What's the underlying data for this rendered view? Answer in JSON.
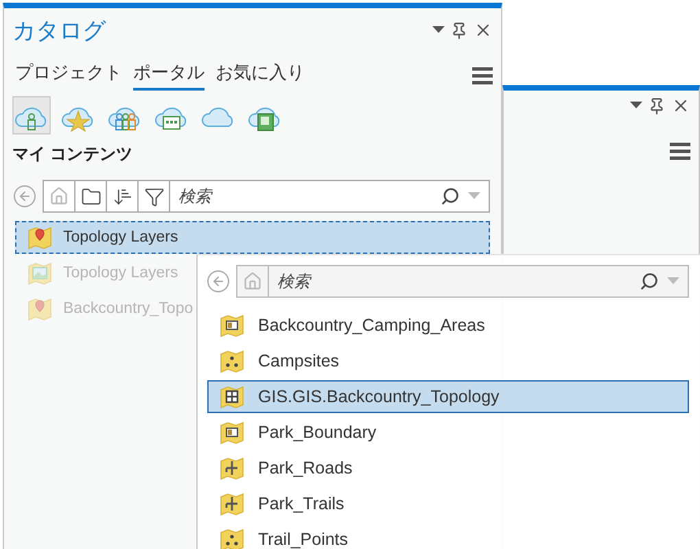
{
  "catalog": {
    "title": "カタログ",
    "tabs": [
      {
        "label": "プロジェクト",
        "selected": false
      },
      {
        "label": "ポータル",
        "selected": true
      },
      {
        "label": "お気に入り",
        "selected": false
      }
    ],
    "portal_buttons": [
      {
        "kind": "my_content",
        "selected": true
      },
      {
        "kind": "favorites",
        "selected": false
      },
      {
        "kind": "groups",
        "selected": false
      },
      {
        "kind": "organization",
        "selected": false
      },
      {
        "kind": "all_portal",
        "selected": false
      },
      {
        "kind": "living_atlas",
        "selected": false
      }
    ],
    "section_label": "マイ コンテンツ",
    "search": {
      "placeholder": "検索"
    },
    "items": [
      {
        "label": "Topology Layers",
        "kind": "map_pin",
        "selected": true,
        "dimmed": false
      },
      {
        "label": "Topology Layers",
        "kind": "map_image",
        "selected": false,
        "dimmed": true
      },
      {
        "label": "Backcountry_Topo",
        "kind": "map_pin",
        "selected": false,
        "dimmed": true
      }
    ]
  },
  "browse_popup": {
    "search": {
      "placeholder": "検索"
    },
    "items": [
      {
        "label": "Backcountry_Camping_Areas",
        "kind": "polygon",
        "selected": false
      },
      {
        "label": "Campsites",
        "kind": "point",
        "selected": false
      },
      {
        "label": "GIS.GIS.Backcountry_Topology",
        "kind": "topology",
        "selected": true
      },
      {
        "label": "Park_Boundary",
        "kind": "polygon",
        "selected": false
      },
      {
        "label": "Park_Roads",
        "kind": "line",
        "selected": false
      },
      {
        "label": "Park_Trails",
        "kind": "line",
        "selected": false
      },
      {
        "label": "Trail_Points",
        "kind": "point",
        "selected": false
      }
    ]
  }
}
